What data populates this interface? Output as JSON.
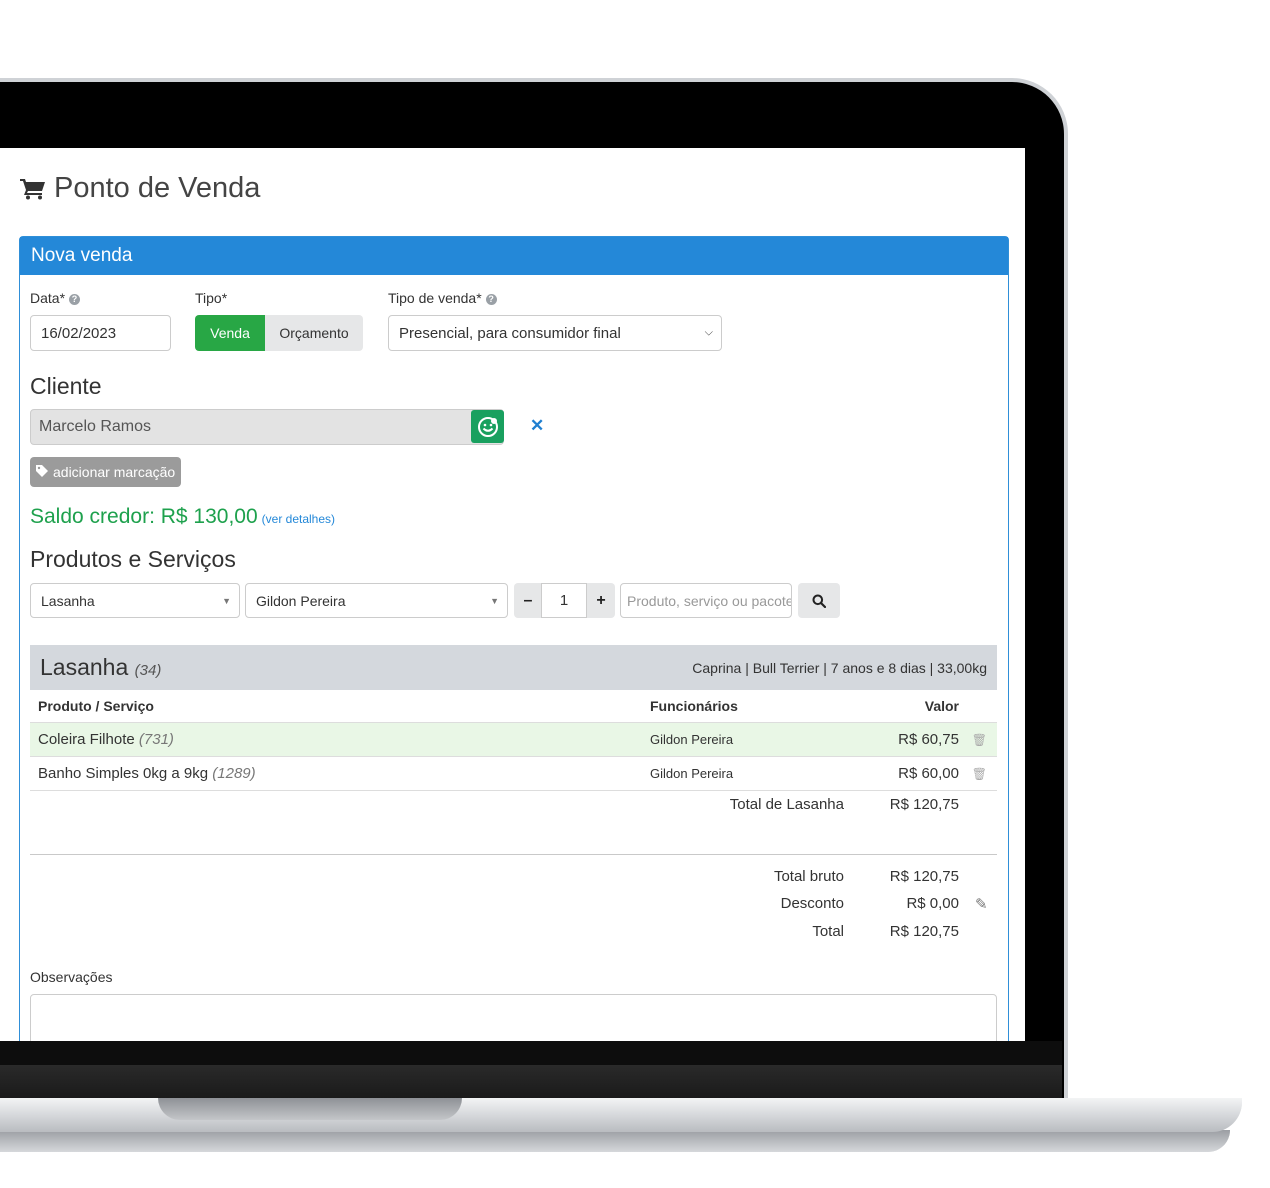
{
  "page": {
    "title": "Ponto de Venda",
    "panel_title": "Nova venda"
  },
  "form": {
    "data_label": "Data*",
    "data_value": "16/02/2023",
    "tipo_label": "Tipo*",
    "tipo_options": [
      "Venda",
      "Orçamento"
    ],
    "tipo_selected": "Venda",
    "tipo_venda_label": "Tipo de venda*",
    "tipo_venda_value": "Presencial, para consumidor final"
  },
  "cliente": {
    "section_title": "Cliente",
    "name": "Marcelo Ramos",
    "tag_button": "adicionar marcação",
    "saldo": "Saldo credor: R$ 130,00",
    "saldo_link": "(ver detalhes)"
  },
  "produtos": {
    "section_title": "Produtos e Serviços",
    "pet_select": "Lasanha",
    "funcionario_select": "Gildon Pereira",
    "quantity": "1",
    "search_placeholder": "Produto, serviço ou pacote"
  },
  "pet": {
    "name": "Lasanha",
    "id": "(34)",
    "info": "Caprina | Bull Terrier | 7 anos e 8 dias | 33,00kg"
  },
  "table": {
    "headers": {
      "produto": "Produto / Serviço",
      "funcionarios": "Funcionários",
      "valor": "Valor"
    },
    "rows": [
      {
        "produto": "Coleira Filhote",
        "codigo": "(731)",
        "funcionario": "Gildon Pereira",
        "valor": "R$ 60,75"
      },
      {
        "produto": "Banho Simples 0kg a 9kg",
        "codigo": "(1289)",
        "funcionario": "Gildon Pereira",
        "valor": "R$ 60,00"
      }
    ],
    "subtotal_label": "Total de Lasanha",
    "subtotal_value": "R$ 120,75"
  },
  "totais": {
    "bruto_label": "Total bruto",
    "bruto_value": "R$ 120,75",
    "desconto_label": "Desconto",
    "desconto_value": "R$ 0,00",
    "total_label": "Total",
    "total_value": "R$ 120,75"
  },
  "observacoes": {
    "label": "Observações"
  },
  "colors": {
    "primary": "#2488d8",
    "success": "#28a745",
    "saldo": "#1ea14d"
  }
}
